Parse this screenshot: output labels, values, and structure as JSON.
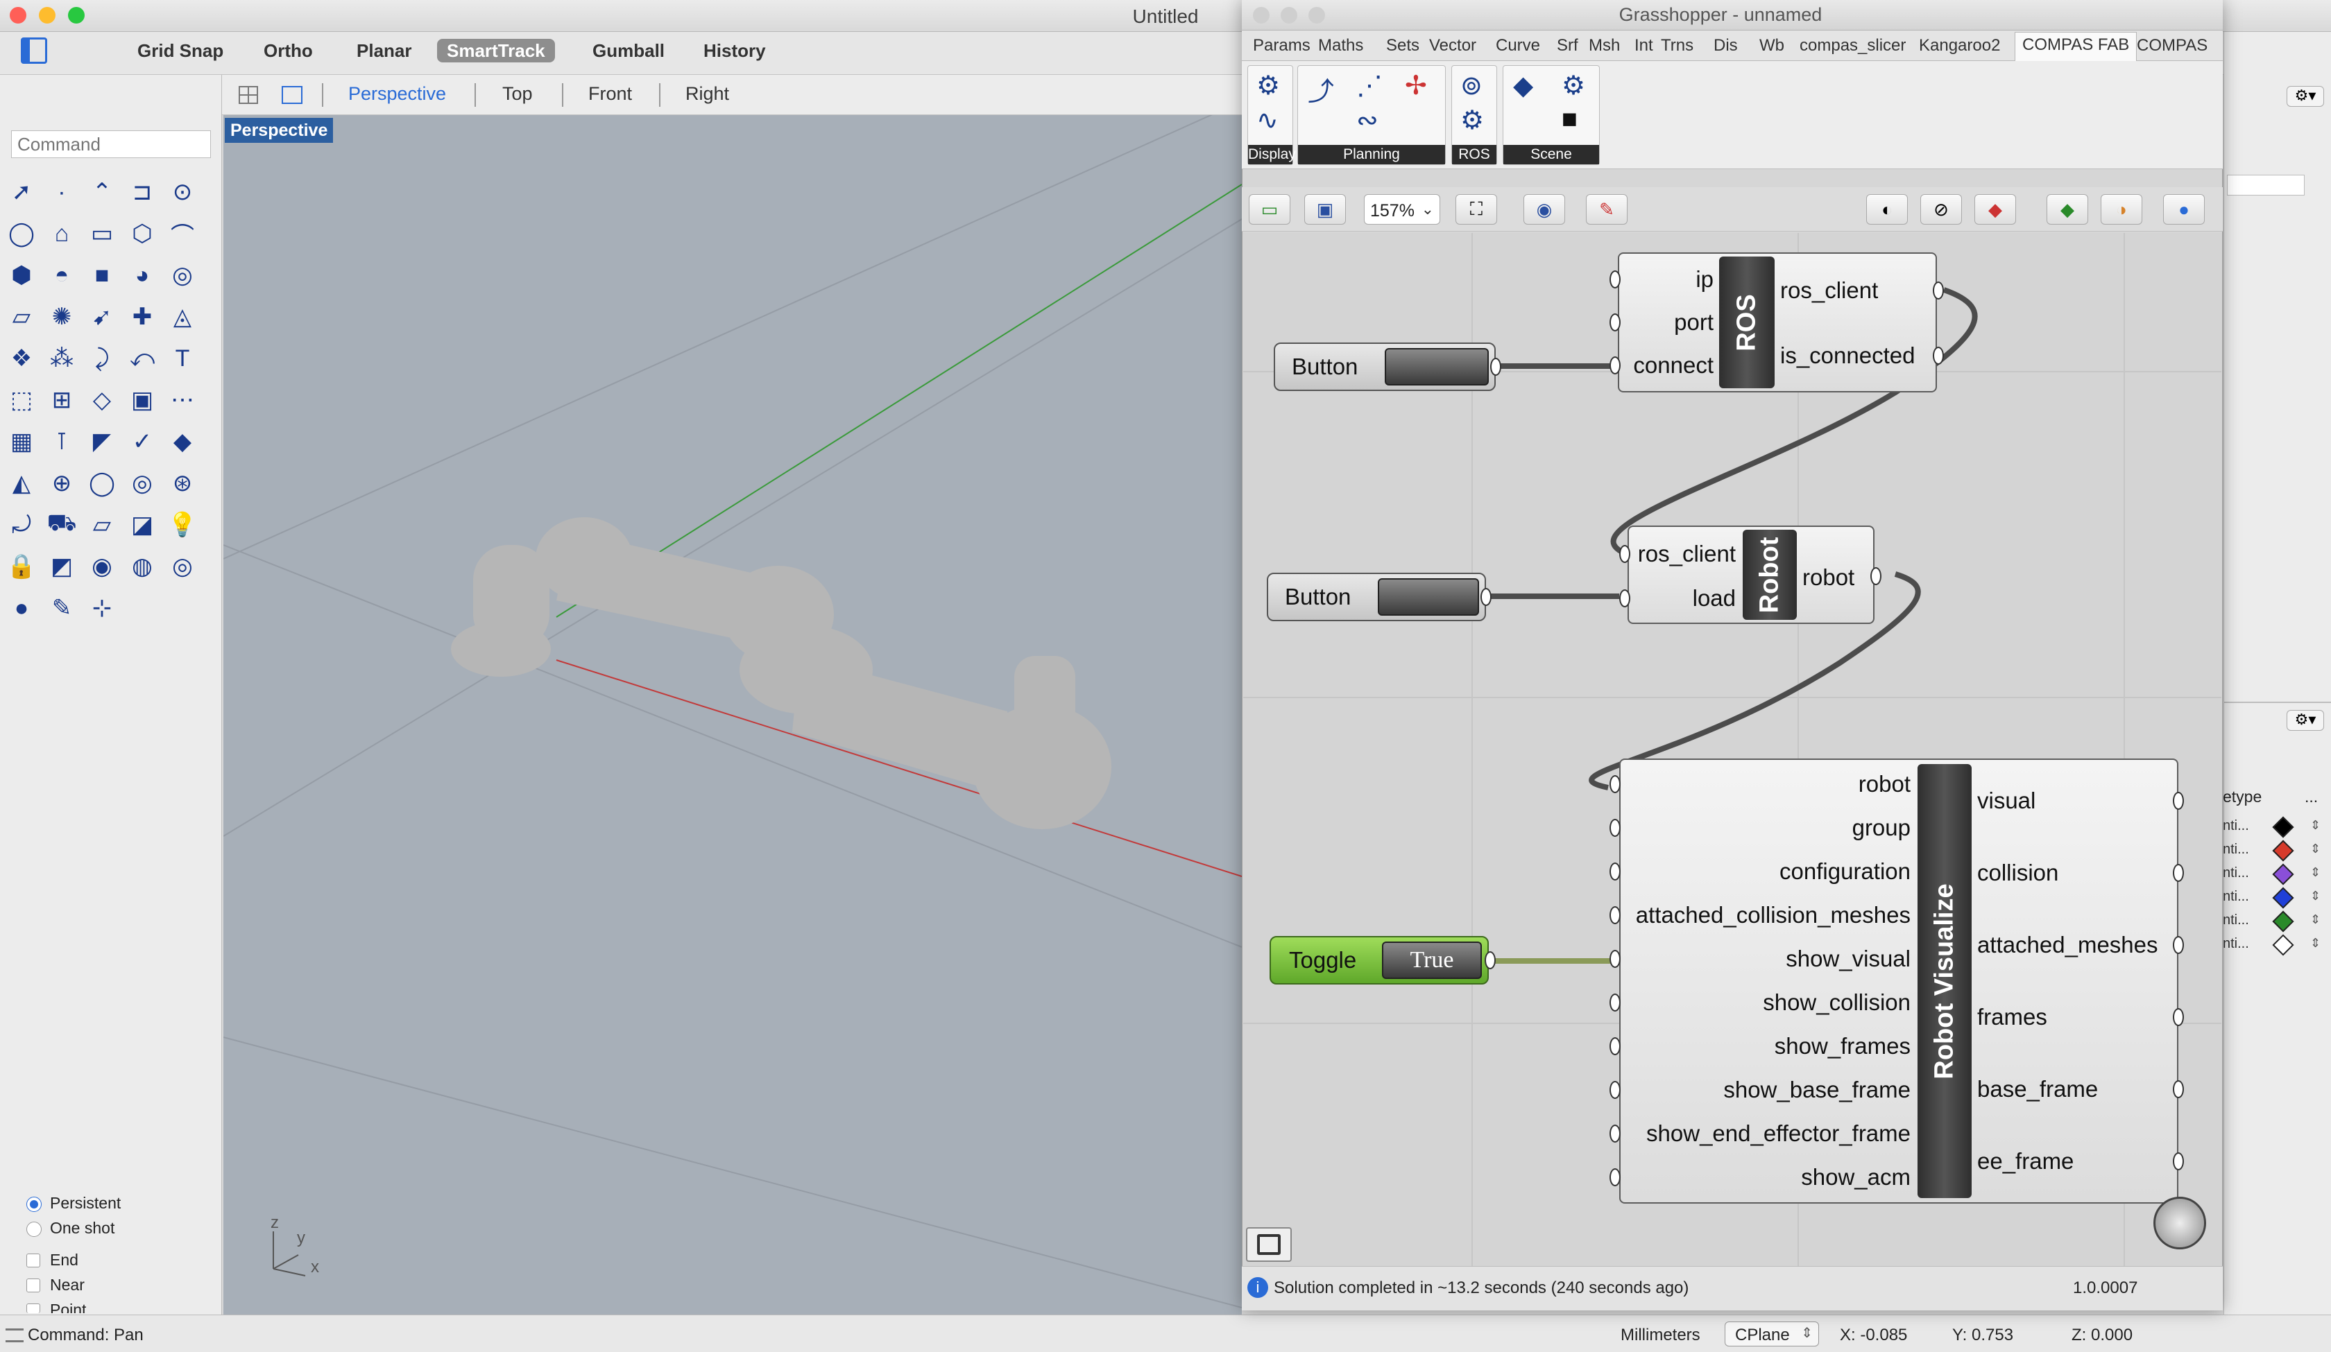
{
  "rhino": {
    "window_title": "Untitled",
    "toolbar": [
      "Grid Snap",
      "Ortho",
      "Planar",
      "SmartTrack",
      "Gumball",
      "History"
    ],
    "active_toolbar_item": "SmartTrack",
    "command_placeholder": "Command",
    "viewport_tabs": [
      "Perspective",
      "Top",
      "Front",
      "Right"
    ],
    "viewport_label": "Perspective",
    "osnap": {
      "persistent": "Persistent",
      "one_shot": "One shot",
      "options": [
        "End",
        "Near",
        "Point"
      ]
    },
    "axis_labels": {
      "z": "z",
      "y": "y",
      "x": "x"
    },
    "status": {
      "command": "Command: Pan",
      "units": "Millimeters",
      "cplane": "CPlane",
      "x": "X: -0.085",
      "y": "Y: 0.753",
      "z": "Z: 0.000"
    },
    "right_panel": {
      "column_header": "etype",
      "more": "...",
      "layer_colors": [
        "#000000",
        "#d73a2a",
        "#8a4fd8",
        "#1f3fd8",
        "#2a8a2a",
        "#ffffff"
      ],
      "layer_names": [
        "nti...",
        "nti...",
        "nti...",
        "nti...",
        "nti...",
        "nti..."
      ]
    }
  },
  "grasshopper": {
    "window_title": "Grasshopper - unnamed",
    "tabs": [
      "Params",
      "Maths",
      "Sets",
      "Vector",
      "Curve",
      "Srf",
      "Msh",
      "Int",
      "Trns",
      "Dis",
      "Wb",
      "compas_slicer",
      "Kangaroo2",
      "COMPAS FAB",
      "COMPAS"
    ],
    "active_tab": "COMPAS FAB",
    "ribbon_groups": [
      "Display",
      "Planning",
      "ROS",
      "Scene"
    ],
    "zoom": "157%",
    "status_message": "Solution completed in ~13.2 seconds (240 seconds ago)",
    "version": "1.0.0007",
    "components": {
      "ros": {
        "name": "ROS",
        "inputs": [
          "ip",
          "port",
          "connect"
        ],
        "outputs": [
          "ros_client",
          "is_connected"
        ]
      },
      "robot": {
        "name": "Robot",
        "inputs": [
          "ros_client",
          "load"
        ],
        "outputs": [
          "robot"
        ]
      },
      "visualize": {
        "name": "Robot Visualize",
        "inputs": [
          "robot",
          "group",
          "configuration",
          "attached_collision_meshes",
          "show_visual",
          "show_collision",
          "show_frames",
          "show_base_frame",
          "show_end_effector_frame",
          "show_acm"
        ],
        "outputs": [
          "visual",
          "collision",
          "attached_meshes",
          "frames",
          "base_frame",
          "ee_frame"
        ]
      }
    },
    "button1": "Button",
    "button2": "Button",
    "toggle": {
      "label": "Toggle",
      "value": "True"
    }
  }
}
